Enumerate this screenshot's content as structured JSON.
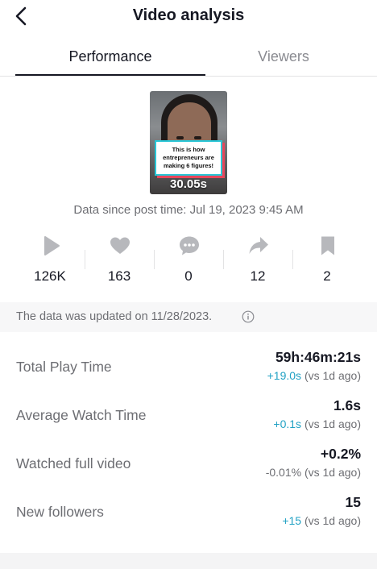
{
  "header": {
    "title": "Video analysis",
    "back_icon": "chevron-left-icon"
  },
  "tabs": [
    {
      "label": "Performance",
      "active": true
    },
    {
      "label": "Viewers",
      "active": false
    }
  ],
  "video": {
    "caption": "This is how entrepreneurs are making 6 figures!",
    "duration": "30.05s"
  },
  "since_text": "Data since post time: Jul 19, 2023 9:45 AM",
  "stats": [
    {
      "icon": "play-icon",
      "value": "126K"
    },
    {
      "icon": "heart-icon",
      "value": "163"
    },
    {
      "icon": "comment-icon",
      "value": "0"
    },
    {
      "icon": "share-icon",
      "value": "12"
    },
    {
      "icon": "bookmark-icon",
      "value": "2"
    }
  ],
  "updated": {
    "text": "The data was updated on 11/28/2023.",
    "icon": "info-icon"
  },
  "metrics": [
    {
      "label": "Total Play Time",
      "value": "59h:46m:21s",
      "change": "+19.0s",
      "compare": " (vs 1d ago)"
    },
    {
      "label": "Average Watch Time",
      "value": "1.6s",
      "change": "+0.1s",
      "compare": " (vs 1d ago)"
    },
    {
      "label": "Watched full video",
      "value": "+0.2%",
      "change": "-0.01%",
      "compare": " (vs 1d ago)"
    },
    {
      "label": "New followers",
      "value": "15",
      "change": "+15",
      "compare": " (vs 1d ago)"
    }
  ],
  "colors": {
    "positive_change": "#21a1c4",
    "icon_gray": "#b7b8bc",
    "text_primary": "#161823",
    "text_secondary": "#6d6e73"
  }
}
